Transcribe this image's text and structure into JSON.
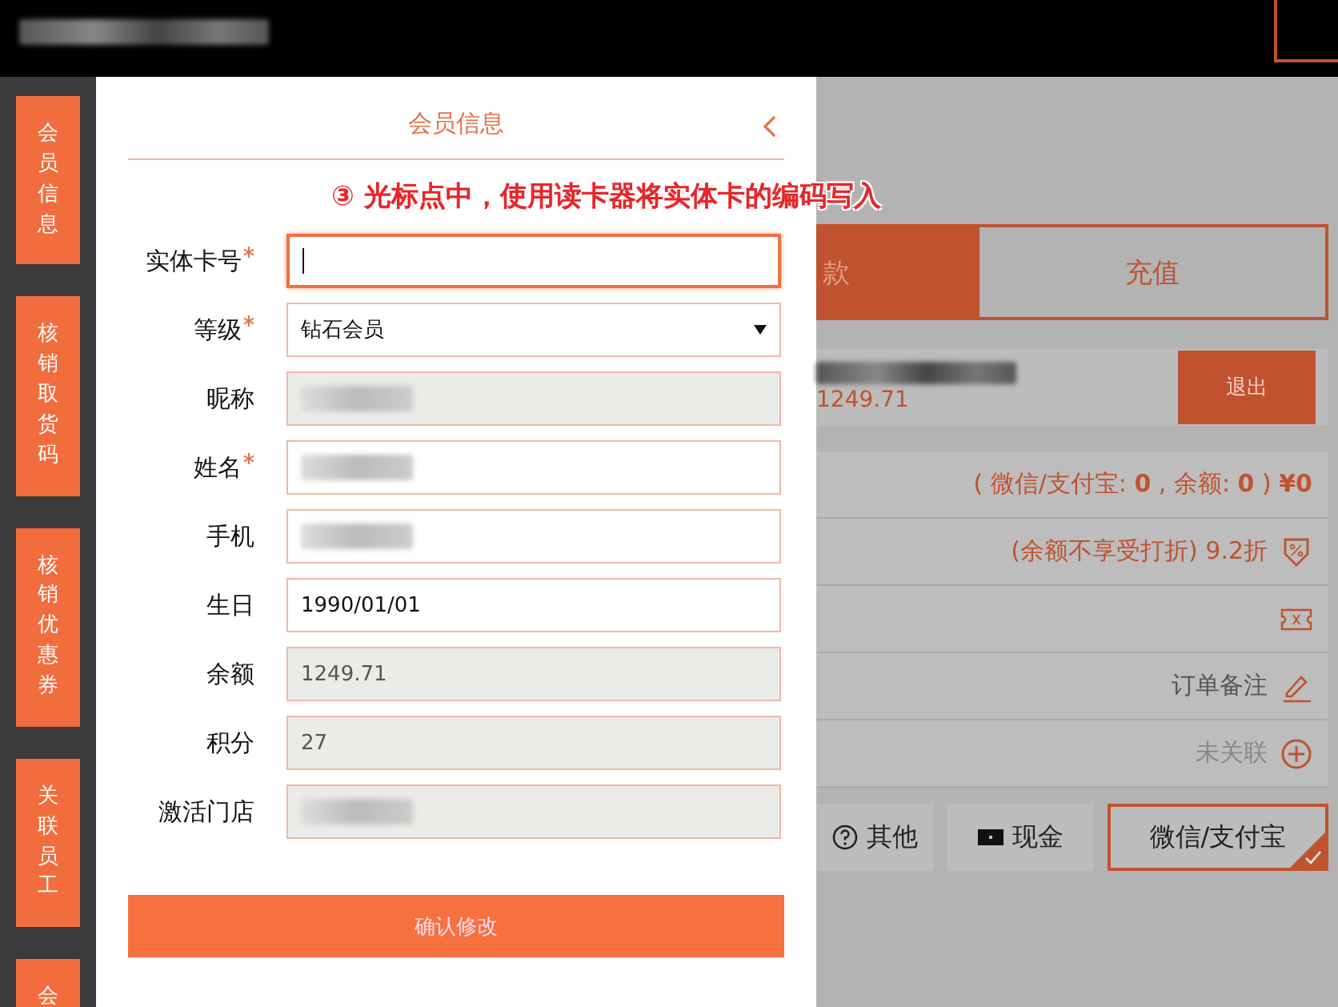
{
  "sidebar": {
    "items": [
      {
        "label": "会员信息"
      },
      {
        "label": "核销取货码"
      },
      {
        "label": "核销优惠券"
      },
      {
        "label": "关联员工"
      },
      {
        "label": "会"
      }
    ]
  },
  "background": {
    "tabs": [
      {
        "label": "款",
        "selected": true
      },
      {
        "label": "充值",
        "selected": false
      }
    ],
    "member": {
      "balance": "1249.71",
      "logout_button": "退出"
    },
    "rows": [
      {
        "kind": "summary",
        "text": "( 微信/支付宝: **0** , 余额: **0** )  **¥0**"
      },
      {
        "kind": "discount",
        "text": "(余额不享受打折)  9.2折"
      },
      {
        "kind": "coupon"
      },
      {
        "kind": "note",
        "text": "订单备注"
      },
      {
        "kind": "staff",
        "text": "未关联"
      }
    ],
    "payment_methods": [
      {
        "kind": "other",
        "label": "其他",
        "selected": false
      },
      {
        "kind": "cash",
        "label": "现金",
        "selected": false
      },
      {
        "kind": "wechat",
        "label": "微信/支付宝",
        "selected": true
      }
    ]
  },
  "modal": {
    "title": "会员信息",
    "fields": [
      {
        "label": "实体卡号",
        "required": true,
        "kind": "text",
        "focused": true
      },
      {
        "label": "等级",
        "required": true,
        "kind": "select",
        "value": "钻石会员",
        "focused": false
      },
      {
        "label": "昵称",
        "required": false,
        "kind": "readonly",
        "focused": false
      },
      {
        "label": "姓名",
        "required": true,
        "kind": "text",
        "focused": false
      },
      {
        "label": "手机",
        "required": false,
        "kind": "text",
        "focused": false
      },
      {
        "label": "生日",
        "required": false,
        "kind": "text",
        "value": "1990/01/01",
        "focused": false
      },
      {
        "label": "余额",
        "required": false,
        "kind": "readonly",
        "value": "1249.71",
        "focused": false
      },
      {
        "label": "积分",
        "required": false,
        "kind": "readonly",
        "value": "27",
        "focused": false
      },
      {
        "label": "激活门店",
        "required": false,
        "kind": "readonly",
        "focused": false
      }
    ],
    "confirm_button": "确认修改"
  },
  "annotation": {
    "text": "③ 光标点中，使用读卡器将实体卡的编码写入"
  }
}
